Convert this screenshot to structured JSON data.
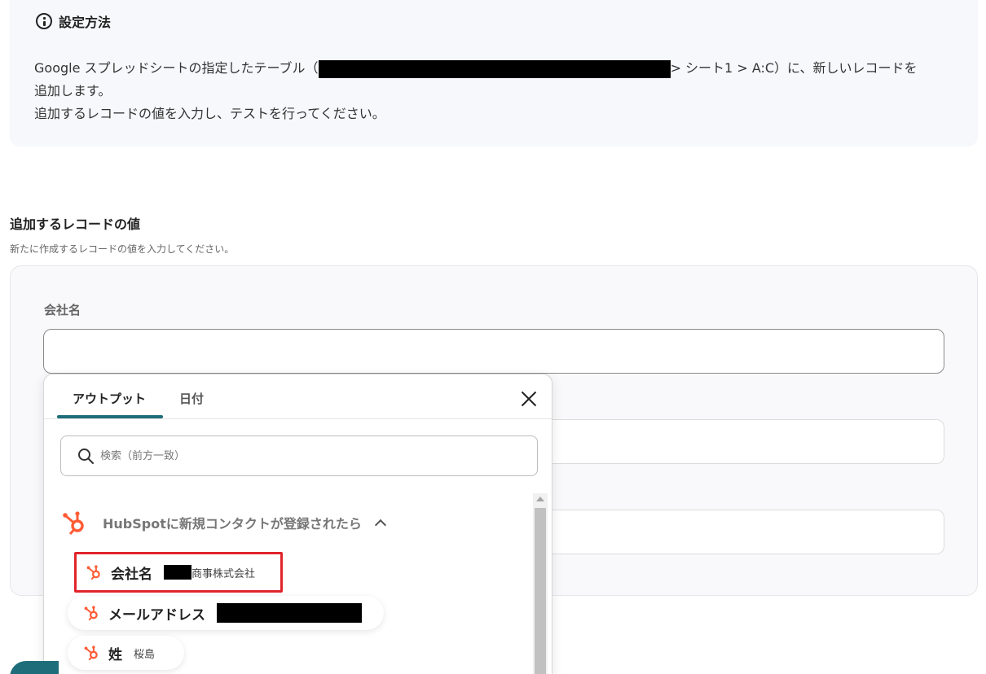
{
  "info": {
    "title": "設定方法",
    "line1_pre": "Google スプレッドシートの指定したテーブル（",
    "line1_post": "> シート1 > A:C）に、新しいレコードを",
    "line2": "追加します。",
    "line3": "追加するレコードの値を入力し、テストを行ってください。"
  },
  "section": {
    "title": "追加するレコードの値",
    "subtitle": "新たに作成するレコードの値を入力してください。"
  },
  "field": {
    "company_label": "会社名",
    "company_value": ""
  },
  "popup": {
    "tabs": [
      {
        "label": "アウトプット",
        "active": true
      },
      {
        "label": "日付",
        "active": false
      }
    ],
    "search_placeholder": "検索（前方一致）",
    "group_label": "HubSpotに新規コンタクトが登録されたら",
    "items": [
      {
        "name": "会社名",
        "value": "商事株式会社"
      },
      {
        "name": "メールアドレス",
        "value": ""
      },
      {
        "name": "姓",
        "value": "桜島"
      }
    ]
  },
  "colors": {
    "accent": "#1e6d7a",
    "hubspot": "#ff5c35",
    "highlight": "#e0242b"
  }
}
